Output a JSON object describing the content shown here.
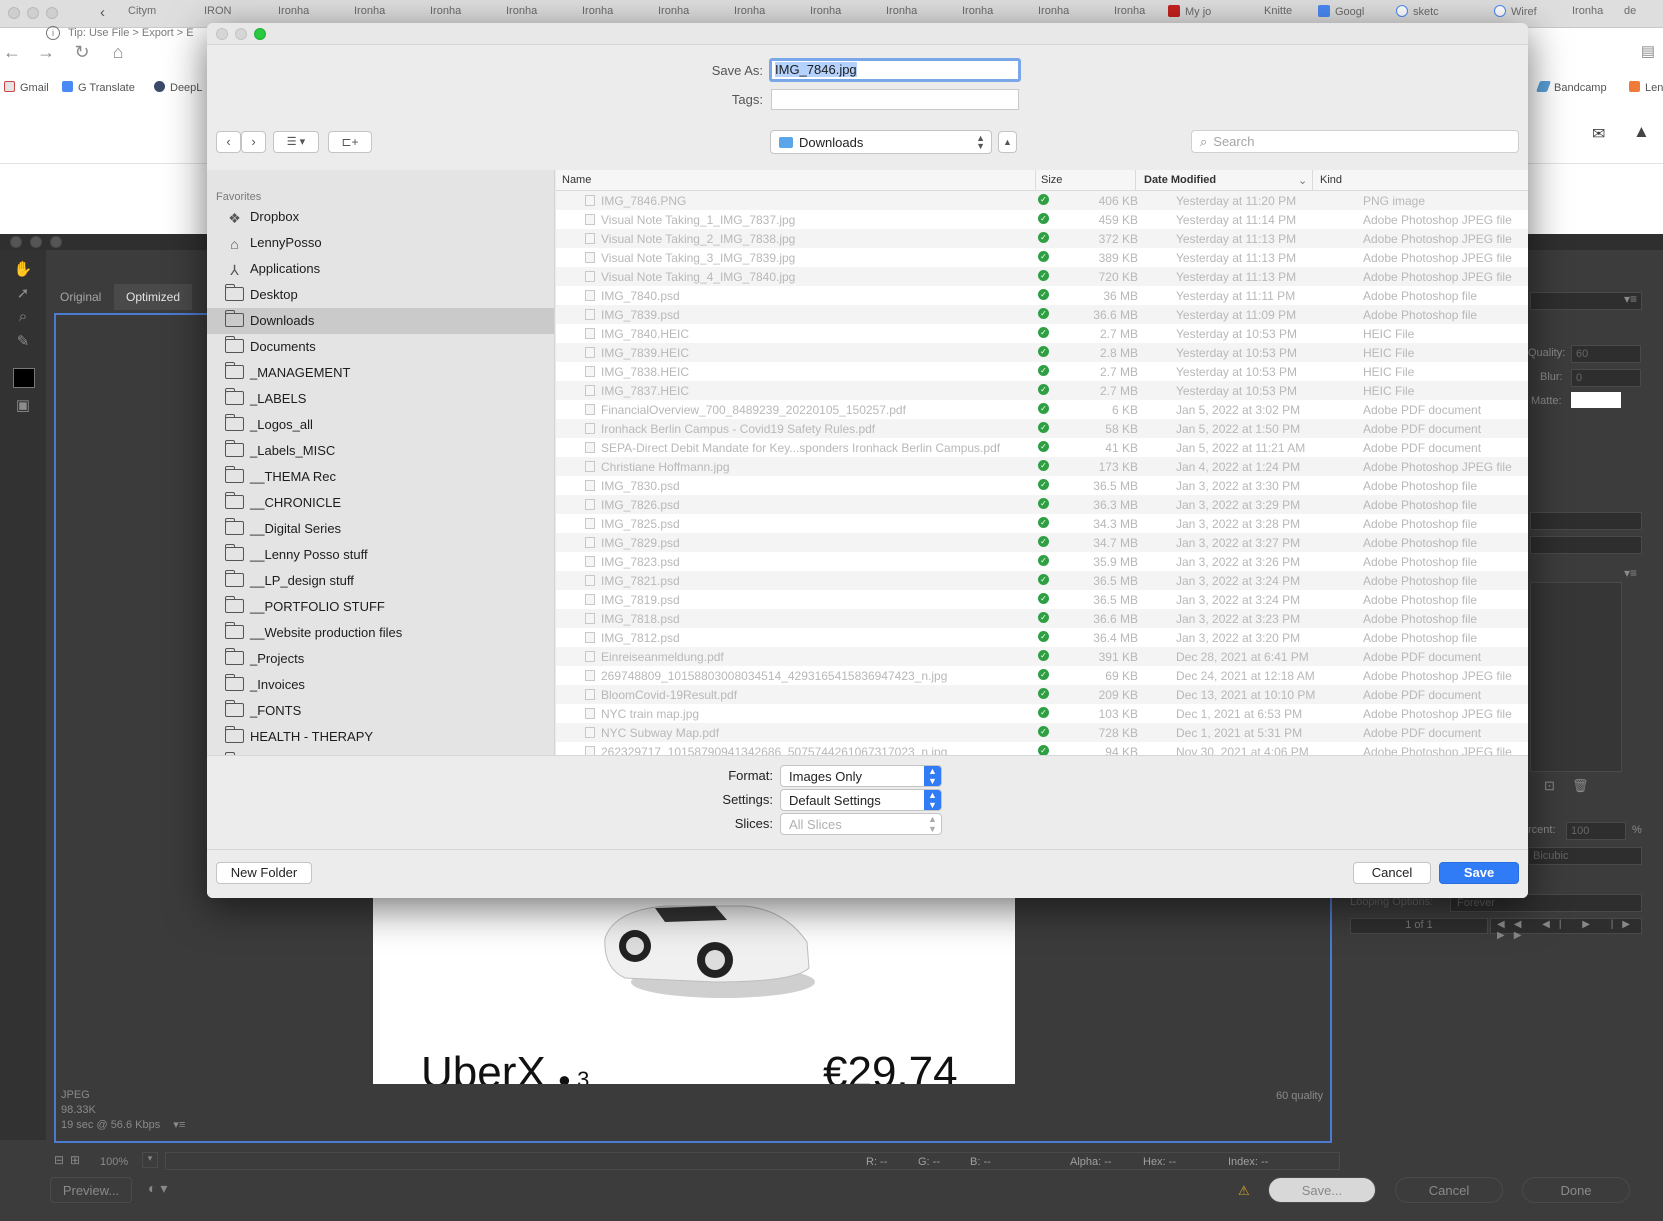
{
  "browser": {
    "tabs": [
      "Citym",
      "IRON",
      "Ironha",
      "Ironha",
      "Ironha",
      "Ironha",
      "Ironha",
      "Ironha",
      "Ironha",
      "Ironha",
      "Ironha",
      "Ironha",
      "Ironha",
      "Ironha",
      "My jo",
      "Knitte",
      "Googl",
      "sketc",
      "Wiref",
      "Ironha",
      "de"
    ],
    "bookmarks": [
      "Gmail",
      "G Translate",
      "DeepL",
      "Bandcamp",
      "Len"
    ]
  },
  "photoshop": {
    "tip": "Tip: Use File > Export > E",
    "tabs": [
      "Original",
      "Optimized"
    ],
    "preview": {
      "ride_name": "UberX",
      "ride_seats": "3",
      "ride_price": "€29.74"
    },
    "info": {
      "format": "JPEG",
      "size": "98.33K",
      "speed": "19 sec @ 56.6 Kbps",
      "quality_note": "60 quality"
    },
    "right_panel": {
      "quality_label": "Quality:",
      "quality_value": "60",
      "blur_label": "Blur:",
      "blur_value": "0",
      "matte_label": "Matte:",
      "percent_label": "rcent:",
      "percent_value": "100",
      "percent_unit": "%",
      "resample": "Bicubic",
      "looping_label": "Looping Options:",
      "looping_value": "Forever",
      "frame_counter": "1 of 1"
    },
    "zoom": "100%",
    "readouts": {
      "r": "R: --",
      "g": "G: --",
      "b": "B: --",
      "alpha": "Alpha: --",
      "hex": "Hex: --",
      "index": "Index: --"
    },
    "buttons": {
      "preview": "Preview...",
      "save": "Save...",
      "cancel": "Cancel",
      "done": "Done"
    }
  },
  "dialog": {
    "save_as_label": "Save As:",
    "save_as_value": "IMG_7846.jpg",
    "tags_label": "Tags:",
    "location": "Downloads",
    "search_placeholder": "Search",
    "sidebar_heading": "Favorites",
    "sidebar": [
      {
        "label": "Dropbox",
        "icon": "dropbox-icon"
      },
      {
        "label": "LennyPosso",
        "icon": "home-icon"
      },
      {
        "label": "Applications",
        "icon": "applications-icon"
      },
      {
        "label": "Desktop",
        "icon": "folder-icon"
      },
      {
        "label": "Downloads",
        "icon": "folder-icon",
        "selected": true
      },
      {
        "label": "Documents",
        "icon": "folder-icon"
      },
      {
        "label": "_MANAGEMENT",
        "icon": "folder-icon"
      },
      {
        "label": "_LABELS",
        "icon": "folder-icon"
      },
      {
        "label": "_Logos_all",
        "icon": "folder-icon"
      },
      {
        "label": "_Labels_MISC",
        "icon": "folder-icon"
      },
      {
        "label": "__THEMA Rec",
        "icon": "folder-icon"
      },
      {
        "label": "__CHRONICLE",
        "icon": "folder-icon"
      },
      {
        "label": "__Digital Series",
        "icon": "folder-icon"
      },
      {
        "label": "__Lenny Posso stuff",
        "icon": "folder-icon"
      },
      {
        "label": "__LP_design stuff",
        "icon": "folder-icon"
      },
      {
        "label": "__PORTFOLIO STUFF",
        "icon": "folder-icon"
      },
      {
        "label": "__Website production files",
        "icon": "folder-icon"
      },
      {
        "label": "_Projects",
        "icon": "folder-icon"
      },
      {
        "label": "_Invoices",
        "icon": "folder-icon"
      },
      {
        "label": "_FONTS",
        "icon": "folder-icon"
      },
      {
        "label": "HEALTH - THERAPY",
        "icon": "folder-icon"
      },
      {
        "label": "_MISC",
        "icon": "folder-icon"
      }
    ],
    "columns": {
      "name": "Name",
      "size": "Size",
      "date": "Date Modified",
      "kind": "Kind"
    },
    "files": [
      {
        "name": "IMG_7846.PNG",
        "size": "406 KB",
        "date": "Yesterday at 11:20 PM",
        "kind": "PNG image"
      },
      {
        "name": "Visual Note Taking_1_IMG_7837.jpg",
        "size": "459 KB",
        "date": "Yesterday at 11:14 PM",
        "kind": "Adobe Photoshop JPEG file"
      },
      {
        "name": "Visual Note Taking_2_IMG_7838.jpg",
        "size": "372 KB",
        "date": "Yesterday at 11:13 PM",
        "kind": "Adobe Photoshop JPEG file"
      },
      {
        "name": "Visual Note Taking_3_IMG_7839.jpg",
        "size": "389 KB",
        "date": "Yesterday at 11:13 PM",
        "kind": "Adobe Photoshop JPEG file"
      },
      {
        "name": "Visual Note Taking_4_IMG_7840.jpg",
        "size": "720 KB",
        "date": "Yesterday at 11:13 PM",
        "kind": "Adobe Photoshop JPEG file"
      },
      {
        "name": "IMG_7840.psd",
        "size": "36 MB",
        "date": "Yesterday at 11:11 PM",
        "kind": "Adobe Photoshop file"
      },
      {
        "name": "IMG_7839.psd",
        "size": "36.6 MB",
        "date": "Yesterday at 11:09 PM",
        "kind": "Adobe Photoshop file"
      },
      {
        "name": "IMG_7840.HEIC",
        "size": "2.7 MB",
        "date": "Yesterday at 10:53 PM",
        "kind": "HEIC File"
      },
      {
        "name": "IMG_7839.HEIC",
        "size": "2.8 MB",
        "date": "Yesterday at 10:53 PM",
        "kind": "HEIC File"
      },
      {
        "name": "IMG_7838.HEIC",
        "size": "2.7 MB",
        "date": "Yesterday at 10:53 PM",
        "kind": "HEIC File"
      },
      {
        "name": "IMG_7837.HEIC",
        "size": "2.7 MB",
        "date": "Yesterday at 10:53 PM",
        "kind": "HEIC File"
      },
      {
        "name": "FinancialOverview_700_8489239_20220105_150257.pdf",
        "size": "6 KB",
        "date": "Jan 5, 2022 at 3:02 PM",
        "kind": "Adobe PDF document"
      },
      {
        "name": "Ironhack Berlin Campus - Covid19 Safety Rules.pdf",
        "size": "58 KB",
        "date": "Jan 5, 2022 at 1:50 PM",
        "kind": "Adobe PDF document"
      },
      {
        "name": "SEPA-Direct Debit Mandate for Key...sponders Ironhack Berlin Campus.pdf",
        "size": "41 KB",
        "date": "Jan 5, 2022 at 11:21 AM",
        "kind": "Adobe PDF document"
      },
      {
        "name": "Christiane Hoffmann.jpg",
        "size": "173 KB",
        "date": "Jan 4, 2022 at 1:24 PM",
        "kind": "Adobe Photoshop JPEG file"
      },
      {
        "name": "IMG_7830.psd",
        "size": "36.5 MB",
        "date": "Jan 3, 2022 at 3:30 PM",
        "kind": "Adobe Photoshop file"
      },
      {
        "name": "IMG_7826.psd",
        "size": "36.3 MB",
        "date": "Jan 3, 2022 at 3:29 PM",
        "kind": "Adobe Photoshop file"
      },
      {
        "name": "IMG_7825.psd",
        "size": "34.3 MB",
        "date": "Jan 3, 2022 at 3:28 PM",
        "kind": "Adobe Photoshop file"
      },
      {
        "name": "IMG_7829.psd",
        "size": "34.7 MB",
        "date": "Jan 3, 2022 at 3:27 PM",
        "kind": "Adobe Photoshop file"
      },
      {
        "name": "IMG_7823.psd",
        "size": "35.9 MB",
        "date": "Jan 3, 2022 at 3:26 PM",
        "kind": "Adobe Photoshop file"
      },
      {
        "name": "IMG_7821.psd",
        "size": "36.5 MB",
        "date": "Jan 3, 2022 at 3:24 PM",
        "kind": "Adobe Photoshop file"
      },
      {
        "name": "IMG_7819.psd",
        "size": "36.5 MB",
        "date": "Jan 3, 2022 at 3:24 PM",
        "kind": "Adobe Photoshop file"
      },
      {
        "name": "IMG_7818.psd",
        "size": "36.6 MB",
        "date": "Jan 3, 2022 at 3:23 PM",
        "kind": "Adobe Photoshop file"
      },
      {
        "name": "IMG_7812.psd",
        "size": "36.4 MB",
        "date": "Jan 3, 2022 at 3:20 PM",
        "kind": "Adobe Photoshop file"
      },
      {
        "name": "Einreiseanmeldung.pdf",
        "size": "391 KB",
        "date": "Dec 28, 2021 at 6:41 PM",
        "kind": "Adobe PDF document"
      },
      {
        "name": "269748809_10158803008034514_4293165415836947423_n.jpg",
        "size": "69 KB",
        "date": "Dec 24, 2021 at 12:18 AM",
        "kind": "Adobe Photoshop JPEG file"
      },
      {
        "name": "BloomCovid-19Result.pdf",
        "size": "209 KB",
        "date": "Dec 13, 2021 at 10:10 PM",
        "kind": "Adobe PDF document"
      },
      {
        "name": "NYC train map.jpg",
        "size": "103 KB",
        "date": "Dec 1, 2021 at 6:53 PM",
        "kind": "Adobe Photoshop JPEG file"
      },
      {
        "name": "NYC Subway Map.pdf",
        "size": "728 KB",
        "date": "Dec 1, 2021 at 5:31 PM",
        "kind": "Adobe PDF document"
      },
      {
        "name": "262329717_10158790941342686_5075744261067317023_n.jpg",
        "size": "94 KB",
        "date": "Nov 30, 2021 at 4:06 PM",
        "kind": "Adobe Photoshop JPEG file"
      }
    ],
    "format_label": "Format:",
    "format_value": "Images Only",
    "settings_label": "Settings:",
    "settings_value": "Default Settings",
    "slices_label": "Slices:",
    "slices_value": "All Slices",
    "new_folder": "New Folder",
    "cancel": "Cancel",
    "save": "Save"
  }
}
